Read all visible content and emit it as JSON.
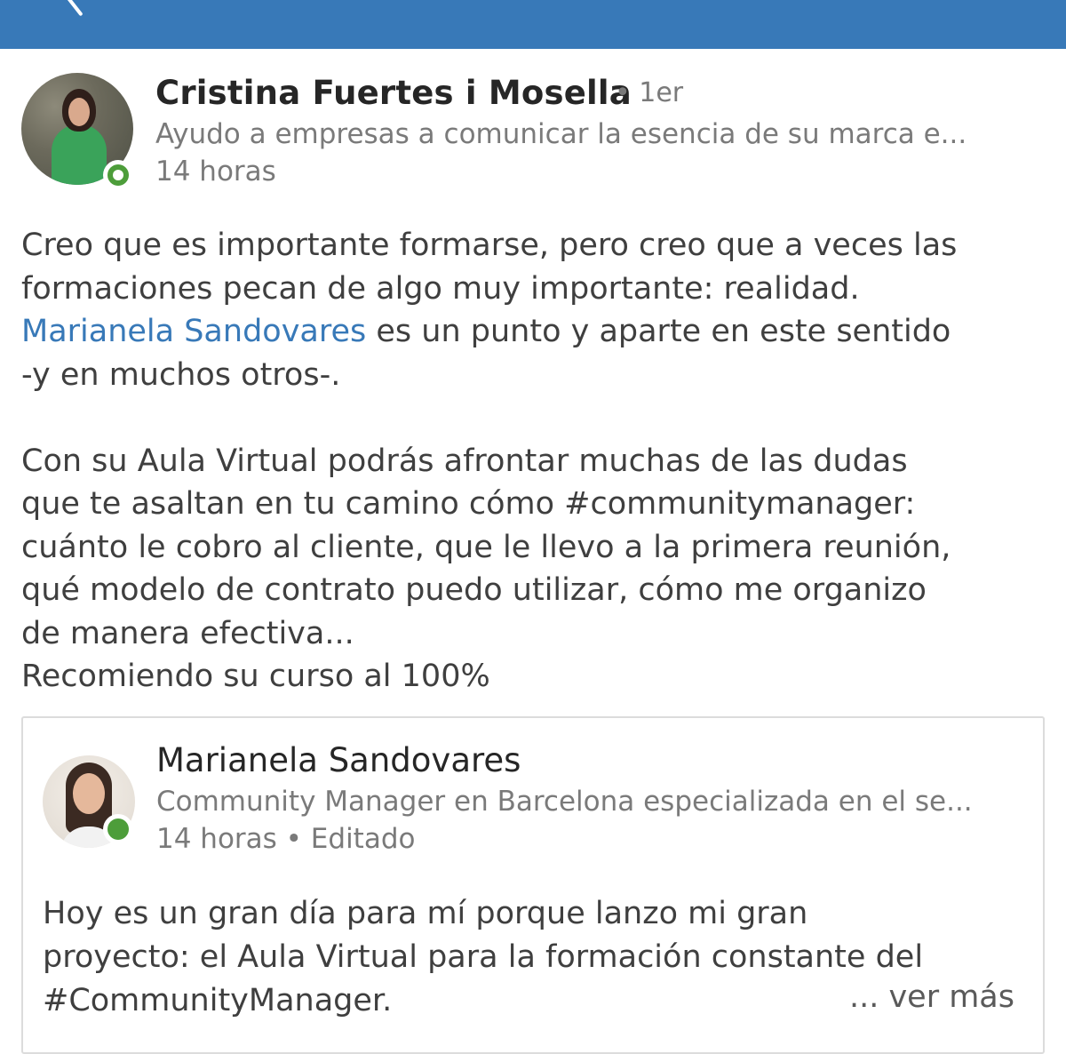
{
  "header": {
    "back_icon": "chevron-left-icon",
    "bg_color": "#3879b8"
  },
  "post": {
    "author_name": "Cristina Fuertes i Mosella",
    "degree": "• 1er",
    "headline": "Ayudo a empresas a comunicar la esencia de su marca e...",
    "timestamp": "14 horas",
    "body": {
      "line1": "Creo que es importante formarse, pero creo que a veces las",
      "line2": "formaciones pecan de algo muy importante: realidad.",
      "mention": "Marianela Sandovares",
      "line3_rest": " es un punto y aparte en este sentido",
      "line4": "-y en muchos otros-.",
      "line5": "Con su Aula Virtual podrás afrontar muchas de las dudas",
      "line6": "que te asaltan en tu camino cómo #communitymanager:",
      "line7": "cuánto le cobro al cliente, que le llevo a la primera reunión,",
      "line8": "qué modelo de contrato puedo utilizar, cómo me organizo",
      "line9": "de manera efectiva...",
      "line10": "Recomiendo su curso al 100%"
    }
  },
  "shared": {
    "author_name": "Marianela Sandovares",
    "headline": "Community Manager en Barcelona especializada en el se...",
    "timestamp": "14 horas • Editado",
    "body": {
      "line1": "Hoy es un gran día para mí porque lanzo mi gran",
      "line2": "proyecto: el Aula Virtual para la formación constante del",
      "line3": "#CommunityManager."
    },
    "see_more": "... ver más"
  },
  "colors": {
    "link": "#3879b8",
    "presence": "#4d9d3a",
    "muted": "#7a7a7a"
  }
}
